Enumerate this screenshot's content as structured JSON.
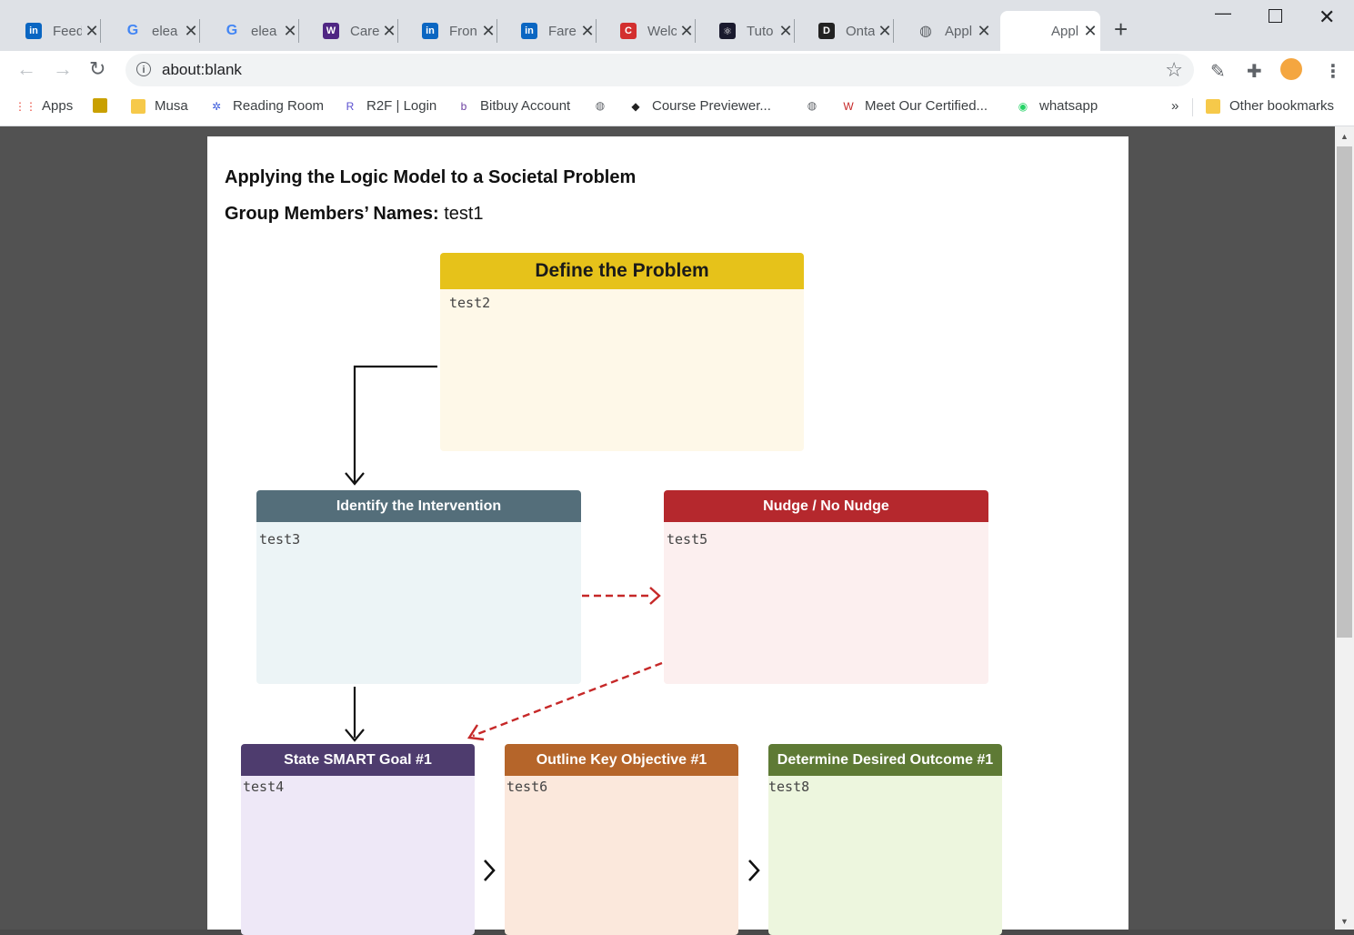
{
  "browser": {
    "tabs": [
      {
        "label": "Feed",
        "icon": "linkedin-icon",
        "color": "#0a66c2",
        "glyph": "in"
      },
      {
        "label": "elea",
        "icon": "google-icon",
        "color": "#4285f4",
        "glyph": "G"
      },
      {
        "label": "elea",
        "icon": "google-icon",
        "color": "#4285f4",
        "glyph": "G"
      },
      {
        "label": "Care",
        "icon": "western-crest-icon",
        "color": "#4f2683",
        "glyph": "W"
      },
      {
        "label": "Fron",
        "icon": "linkedin-icon",
        "color": "#0a66c2",
        "glyph": "in"
      },
      {
        "label": "Fare",
        "icon": "linkedin-icon",
        "color": "#0a66c2",
        "glyph": "in"
      },
      {
        "label": "Welc",
        "icon": "c-logo-icon",
        "color": "#d32f2f",
        "glyph": "C"
      },
      {
        "label": "Tuto",
        "icon": "react-icon",
        "color": "#1a1a2e",
        "glyph": "⚛"
      },
      {
        "label": "Onta",
        "icon": "dms-icon",
        "color": "#222222",
        "glyph": "D"
      },
      {
        "label": "Appl",
        "icon": "globe-icon",
        "color": "#5f6368",
        "glyph": "◍"
      },
      {
        "label": "Appl",
        "icon": "blank-page-icon",
        "color": "#ffffff",
        "glyph": ""
      }
    ],
    "url": "about:blank",
    "bookmarks": [
      {
        "label": "Apps",
        "icon": "apps-grid-icon"
      },
      {
        "label": "",
        "icon": "turtle-icon"
      },
      {
        "label": "Musa",
        "icon": "folder-icon"
      },
      {
        "label": "Reading Room",
        "icon": "sparkle-icon"
      },
      {
        "label": "R2F | Login",
        "icon": "r2f-icon"
      },
      {
        "label": "Bitbuy Account",
        "icon": "bitbuy-icon"
      },
      {
        "label": "",
        "icon": "globe-icon"
      },
      {
        "label": "Course Previewer...",
        "icon": "shield-logo-icon"
      },
      {
        "label": "",
        "icon": "globe-icon"
      },
      {
        "label": "Meet Our Certified...",
        "icon": "wb-logo-icon"
      },
      {
        "label": "whatsapp",
        "icon": "whatsapp-icon"
      }
    ],
    "overflow": "»",
    "other_bookmarks": "Other bookmarks"
  },
  "document": {
    "title": "Applying the Logic Model to a Societal Problem",
    "members_label": "Group Members’ Names:",
    "members_value": "test1",
    "boxes": {
      "define": {
        "title": "Define the Problem",
        "value": "test2",
        "head_color": "#e6c21a",
        "body_color": "#fef8e8"
      },
      "intervention": {
        "title": "Identify the Intervention",
        "value": "test3",
        "head_color": "#546e7a",
        "body_color": "#ecf4f6"
      },
      "nudge": {
        "title": "Nudge / No Nudge",
        "value": "test5",
        "head_color": "#b5282d",
        "body_color": "#fcefef"
      },
      "goal": {
        "title": "State SMART Goal #1",
        "value": "test4",
        "head_color": "#4e3c6e",
        "body_color": "#eee8f7"
      },
      "objective": {
        "title": "Outline Key Objective #1",
        "value": "test6",
        "head_color": "#b5652a",
        "body_color": "#fbe8dc"
      },
      "outcome": {
        "title": "Determine Desired Outcome #1",
        "value": "test8",
        "head_color": "#5e7a35",
        "body_color": "#edf6de"
      }
    }
  }
}
